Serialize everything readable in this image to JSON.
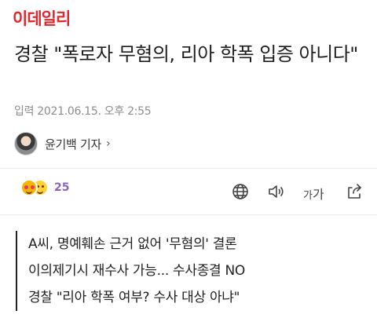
{
  "brand": {
    "logo_text": "이데일리",
    "color": "#e4262c"
  },
  "article": {
    "headline": "경찰 \"폭로자 무혐의, 리아 학폭 입증 아니다\"",
    "dateline": "입력 2021.06.15. 오후 2:55"
  },
  "author": {
    "name": "윤기백 기자",
    "chevron": "›",
    "avatar_icon": "person-photo"
  },
  "reactions": {
    "count": "25",
    "accent": "#8a63b8"
  },
  "toolbar": {
    "translate_icon": "globe-icon",
    "audio_icon": "speaker-icon",
    "font_size_small": "가",
    "font_size_large": "가",
    "share_icon": "share-icon"
  },
  "summary": {
    "lines": [
      "A씨, 명예훼손 근거 없어 '무혐의' 결론",
      "이의제기시 재수사 가능... 수사종결 NO",
      "경찰 \"리아 학폭 여부? 수사 대상 아냐\""
    ]
  }
}
